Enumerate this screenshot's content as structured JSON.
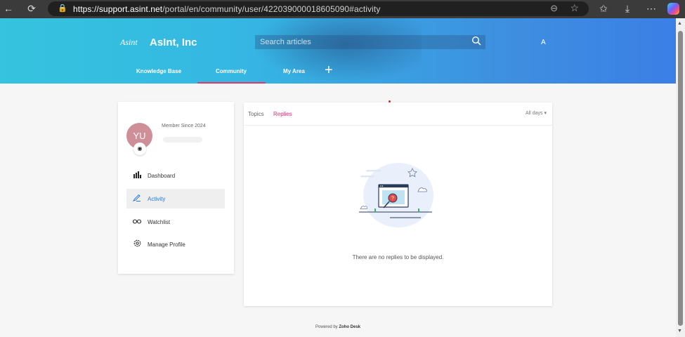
{
  "browser": {
    "url_host": "https://support.asint.net",
    "url_path": "/portal/en/community/user/42203900001860509​0#activity"
  },
  "header": {
    "logo_text": "Asint",
    "brand_name": "AsInt, Inc",
    "search_placeholder": "Search articles",
    "translate_label": "A",
    "nav": [
      "Knowledge Base",
      "Community",
      "My Area"
    ],
    "plus_label": "+"
  },
  "profile": {
    "initials": "YU",
    "member_since": "Member Since 2024",
    "avatar_color": "#cf8f98",
    "menu": [
      {
        "label": "Dashboard",
        "icon": "bar-chart-icon"
      },
      {
        "label": "Activity",
        "icon": "pen-icon"
      },
      {
        "label": "Watchlist",
        "icon": "binoculars-icon"
      },
      {
        "label": "Manage Profile",
        "icon": "gear-icon"
      }
    ]
  },
  "activity": {
    "tabs": [
      "Topics",
      "Replies"
    ],
    "active_tab": "Replies",
    "filter": "All days",
    "empty_message": "There are no replies to be displayed."
  },
  "footer": {
    "powered_by": "Powered by",
    "powered_brand": "Zoho Desk"
  },
  "colors": {
    "accent": "#e0336d",
    "link": "#2f78d0"
  }
}
